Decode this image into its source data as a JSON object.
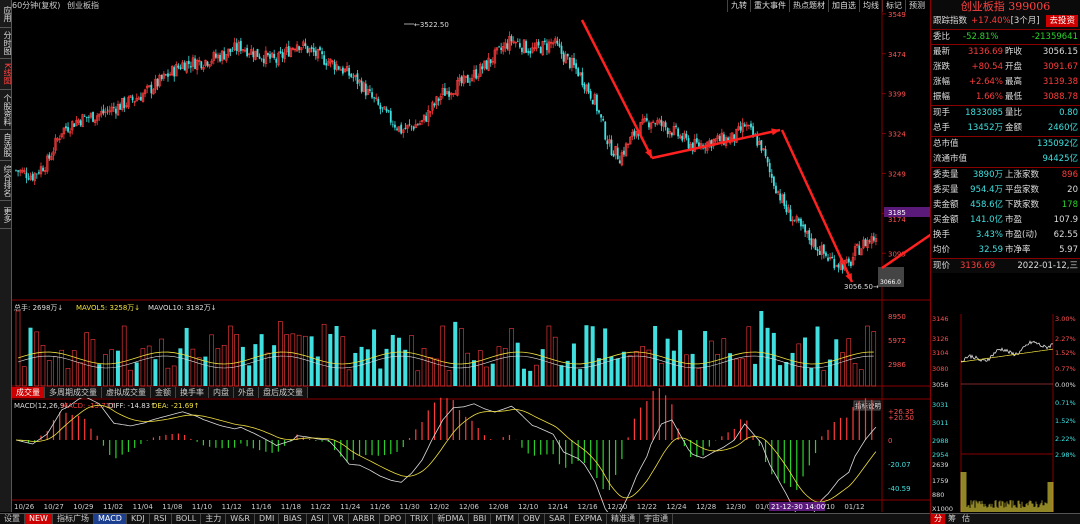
{
  "app": {
    "window_title": "60分钟(复权)",
    "instrument": "创业板指"
  },
  "leftnav": [
    "应用",
    "分时图",
    "K线图",
    "个股资料",
    "自选股",
    "综合排名",
    "更多"
  ],
  "toolbar": [
    "九转",
    "重大事件",
    "热点题材",
    "加自选",
    "均线",
    "标记",
    "预测"
  ],
  "price_axis": [
    "3549",
    "3474",
    "3399",
    "3324",
    "3249",
    "3174",
    "3099"
  ],
  "axis_marker": "3185",
  "axis_marker2": "3174",
  "annotations": {
    "high": "3522.50",
    "low": "3056.50",
    "last": "3066.0"
  },
  "volume": {
    "header": {
      "total": "总手: 2698万↓",
      "ma5": "MAVOL5: 3258万↓",
      "ma10": "MAVOL10: 3182万↓"
    },
    "axis": [
      "8950",
      "5972",
      "2986"
    ]
  },
  "subtabs": [
    "成交量",
    "多周期成交量",
    "虚拟成交量",
    "金额",
    "换手率",
    "内盘",
    "外盘",
    "盘后成交量"
  ],
  "macd": {
    "header": {
      "name": "MACD(12,26,9)",
      "macd": "MACD: -13.71↑",
      "diff": "DIFF: -14.83↑",
      "dea": "DEA: -21.69↑"
    },
    "button": "指标说明",
    "axis": [
      "+26.35",
      "+20.50",
      "0",
      "-20.07",
      "-40.59"
    ]
  },
  "dates": [
    "10/26",
    "10/27",
    "10/29",
    "11/02",
    "11/04",
    "11/08",
    "11/10",
    "11/12",
    "11/16",
    "11/18",
    "11/22",
    "11/24",
    "11/26",
    "11/30",
    "12/02",
    "12/06",
    "12/08",
    "12/10",
    "12/14",
    "12/16",
    "12/20",
    "12/22",
    "12/24",
    "12/28",
    "12/30",
    "01/04",
    "01/06",
    "01/10",
    "01/12"
  ],
  "date_highlight": "21-12-30 14:00",
  "bottom_tabs": [
    "设置",
    "NEW",
    "指标广场",
    "MACD",
    "KDJ",
    "RSI",
    "BOLL",
    "主力",
    "W&R",
    "DMI",
    "BIAS",
    "ASI",
    "VR",
    "ARBR",
    "DPO",
    "TRIX",
    "新DMA",
    "BBI",
    "MTM",
    "OBV",
    "SAR",
    "EXPMA",
    "精准通",
    "宇宙通"
  ],
  "panel": {
    "title": "创业板指",
    "code": "399006",
    "track": {
      "label": "跟踪指数",
      "value": "+17.40%",
      "period": "[3个月]",
      "button": "去投资"
    },
    "weibi": {
      "l": "委比",
      "v": "-52.81%",
      "v2": "-21359641"
    },
    "rows1": [
      {
        "l1": "最新",
        "v1": "3136.69",
        "l2": "昨收",
        "v2": "3056.15"
      },
      {
        "l1": "涨跌",
        "v1": "+80.54",
        "l2": "开盘",
        "v2": "3091.67"
      },
      {
        "l1": "涨幅",
        "v1": "+2.64%",
        "l2": "最高",
        "v2": "3139.38"
      },
      {
        "l1": "振幅",
        "v1": "1.66%",
        "l2": "最低",
        "v2": "3088.78"
      }
    ],
    "rows2": [
      {
        "l1": "现手",
        "v1": "1833085",
        "l2": "量比",
        "v2": "0.80"
      },
      {
        "l1": "总手",
        "v1": "13452万",
        "l2": "金额",
        "v2": "2460亿"
      }
    ],
    "rows3": [
      {
        "l": "总市值",
        "v": "135092亿"
      },
      {
        "l": "流通市值",
        "v": "94425亿"
      }
    ],
    "rows4": [
      {
        "l1": "委卖量",
        "v1": "3890万",
        "l2": "上涨家数",
        "v2": "896"
      },
      {
        "l1": "委买量",
        "v1": "954.4万",
        "l2": "平盘家数",
        "v2": "20"
      },
      {
        "l1": "卖金额",
        "v1": "458.6亿",
        "l2": "下跌家数",
        "v2": "178"
      },
      {
        "l1": "买金额",
        "v1": "141.0亿",
        "l2": "市盈",
        "v2": "107.9"
      },
      {
        "l1": "换手",
        "v1": "3.43%",
        "l2": "市盈(动)",
        "v2": "62.55"
      },
      {
        "l1": "均价",
        "v1": "32.59",
        "l2": "市净率",
        "v2": "5.97"
      }
    ],
    "mini": {
      "label": "现价",
      "price": "3136.69",
      "date": "2022-01-12,三",
      "axis_left": [
        "3146",
        "3126",
        "3104",
        "3080",
        "3056",
        "3031",
        "3011",
        "2988",
        "2954",
        "2639",
        "1759",
        "880",
        "X1000"
      ],
      "axis_right": [
        "3.00%",
        "2.27%",
        "1.52%",
        "0.77%",
        "0.00%",
        "0.71%",
        "1.52%",
        "2.22%",
        "2.98%"
      ]
    },
    "tabs": [
      "分",
      "筹",
      "估"
    ]
  },
  "chart_data": {
    "type": "candlestick",
    "title": "创业板指 60分钟",
    "ylim": [
      3056.5,
      3549
    ],
    "high": 3522.5,
    "low": 3056.5,
    "close_last": 3136.69
  }
}
